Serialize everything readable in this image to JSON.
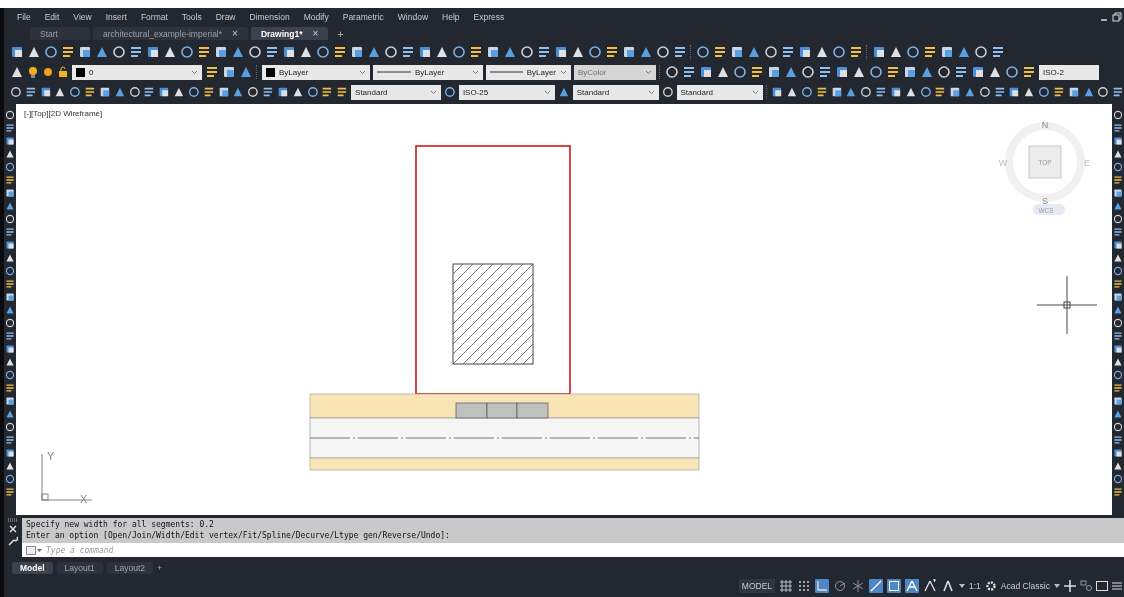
{
  "menu": [
    "File",
    "Edit",
    "View",
    "Insert",
    "Format",
    "Tools",
    "Draw",
    "Dimension",
    "Modify",
    "Parametric",
    "Window",
    "Help",
    "Express"
  ],
  "doc_tabs": [
    {
      "label": "Start",
      "selected": false
    },
    {
      "label": "architectural_example-imperial*",
      "close": "×",
      "selected": false
    },
    {
      "label": "Drawing1*",
      "close": "×",
      "selected": true
    }
  ],
  "new_tab": "+",
  "layer_bar": {
    "layer": "0",
    "color_control": "ByLayer",
    "linetype": "ByLayer",
    "lineweight": "ByLayer",
    "plot_style": {
      "value": "ByColor",
      "disabled": true
    },
    "dim_style": "ISO-2"
  },
  "styles_bar": {
    "text_style": "Standard",
    "dim_style": "ISO-25",
    "table_style": "Standard",
    "multileader_style": "Standard"
  },
  "viewport": {
    "label": "[-][Top][2D Wireframe]",
    "viewcube": {
      "north": "N",
      "west": "W",
      "face": "TOP",
      "east": "E",
      "south": "S",
      "coords": "WCS"
    },
    "axis_y": "Y",
    "axis_x": "X"
  },
  "command": {
    "history": [
      "Specify new width for all segments: 0.2",
      "Enter an option [Open/Join/Width/Edit vertex/Fit/Spline/Decurve/Ltype gen/Reverse/Undo]:"
    ],
    "placeholder": "Type a command"
  },
  "layout_tabs": [
    {
      "label": "Model",
      "selected": true
    },
    {
      "label": "Layout1",
      "selected": false
    },
    {
      "label": "Layout2",
      "selected": false
    }
  ],
  "add_layout": "+",
  "status": {
    "space": "MODEL",
    "toggles": [
      {
        "kind": "grid",
        "on": false
      },
      {
        "kind": "snap",
        "on": false
      },
      {
        "kind": "ortho",
        "on": true
      },
      {
        "kind": "polar",
        "on": false
      },
      {
        "kind": "isodraft",
        "on": false
      },
      {
        "kind": "track",
        "on": true
      },
      {
        "kind": "osnap",
        "on": true
      },
      {
        "kind": "annovis",
        "on": true
      },
      {
        "kind": "autoscale",
        "on": false
      },
      {
        "kind": "anno",
        "on": false
      }
    ],
    "scale": "1:1",
    "workspace": "Acad Classic"
  }
}
